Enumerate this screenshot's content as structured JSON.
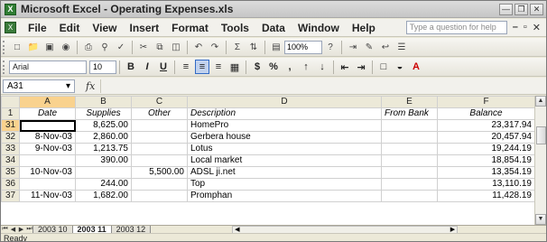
{
  "window": {
    "title": "Microsoft Excel - Operating Expenses.xls"
  },
  "menu": {
    "items": [
      "File",
      "Edit",
      "View",
      "Insert",
      "Format",
      "Tools",
      "Data",
      "Window",
      "Help"
    ],
    "help_placeholder": "Type a question for help"
  },
  "toolbar": {
    "zoom": "100%",
    "font": "Arial",
    "font_size": "10",
    "currency": "$",
    "percent": "%",
    "comma": ","
  },
  "formula_bar": {
    "name_box": "A31",
    "fx": "fx",
    "formula": ""
  },
  "sheet": {
    "columns": [
      "A",
      "B",
      "C",
      "D",
      "E",
      "F"
    ],
    "header_row_number": "1",
    "headers": [
      "Date",
      "Supplies",
      "Other",
      "Description",
      "From Bank",
      "Balance"
    ],
    "rows": [
      {
        "num": "31",
        "cells": [
          "",
          "8,625.00",
          "",
          "HomePro",
          "",
          "23,317.94"
        ]
      },
      {
        "num": "32",
        "cells": [
          "8-Nov-03",
          "2,860.00",
          "",
          "Gerbera house",
          "",
          "20,457.94"
        ]
      },
      {
        "num": "33",
        "cells": [
          "9-Nov-03",
          "1,213.75",
          "",
          "Lotus",
          "",
          "19,244.19"
        ]
      },
      {
        "num": "34",
        "cells": [
          "",
          "390.00",
          "",
          "Local market",
          "",
          "18,854.19"
        ]
      },
      {
        "num": "35",
        "cells": [
          "10-Nov-03",
          "",
          "5,500.00",
          "ADSL ji.net",
          "",
          "13,354.19"
        ]
      },
      {
        "num": "36",
        "cells": [
          "",
          "244.00",
          "",
          "Top",
          "",
          "13,110.19"
        ]
      },
      {
        "num": "37",
        "cells": [
          "11-Nov-03",
          "1,682.00",
          "",
          "Promphan",
          "",
          "11,428.19"
        ]
      }
    ]
  },
  "tabs": {
    "items": [
      "2003 10",
      "2003 11",
      "2003 12"
    ],
    "active": "2003 11"
  },
  "status": {
    "text": "Ready"
  }
}
